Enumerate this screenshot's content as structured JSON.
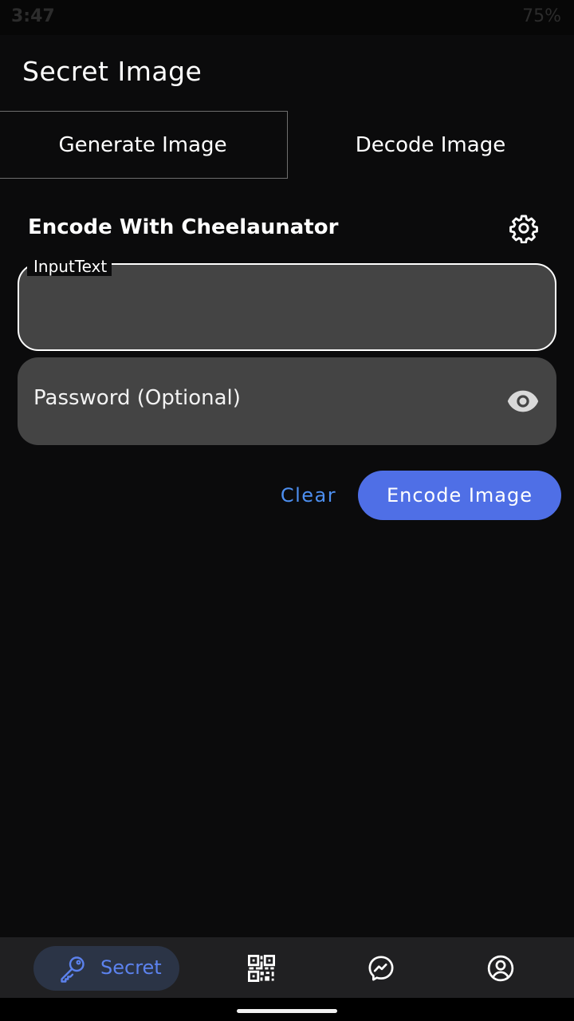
{
  "status_bar": {
    "time": "3:47",
    "battery": "75%"
  },
  "app": {
    "title": "Secret Image"
  },
  "tabs": [
    {
      "label": "Generate Image",
      "selected": true
    },
    {
      "label": "Decode Image",
      "selected": false
    }
  ],
  "section": {
    "title": "Encode With Cheelaunator",
    "settings_icon": "gear-icon"
  },
  "form": {
    "input_label": "InputText",
    "input_value": "",
    "password_placeholder": "Password (Optional)",
    "password_icon": "eye-icon"
  },
  "actions": {
    "clear_label": "Clear",
    "encode_label": "Encode Image"
  },
  "bottom_nav": {
    "items": [
      {
        "label": "Secret",
        "icon": "key-icon",
        "active": true
      },
      {
        "label": "",
        "icon": "qr-code-icon",
        "active": false
      },
      {
        "label": "",
        "icon": "messenger-icon",
        "active": false
      },
      {
        "label": "",
        "icon": "profile-icon",
        "active": false
      }
    ]
  },
  "colors": {
    "background": "#0b0b0c",
    "field": "#444444",
    "accent": "#4f6fe6",
    "link": "#4d8ff0",
    "nav_background": "#202022"
  }
}
